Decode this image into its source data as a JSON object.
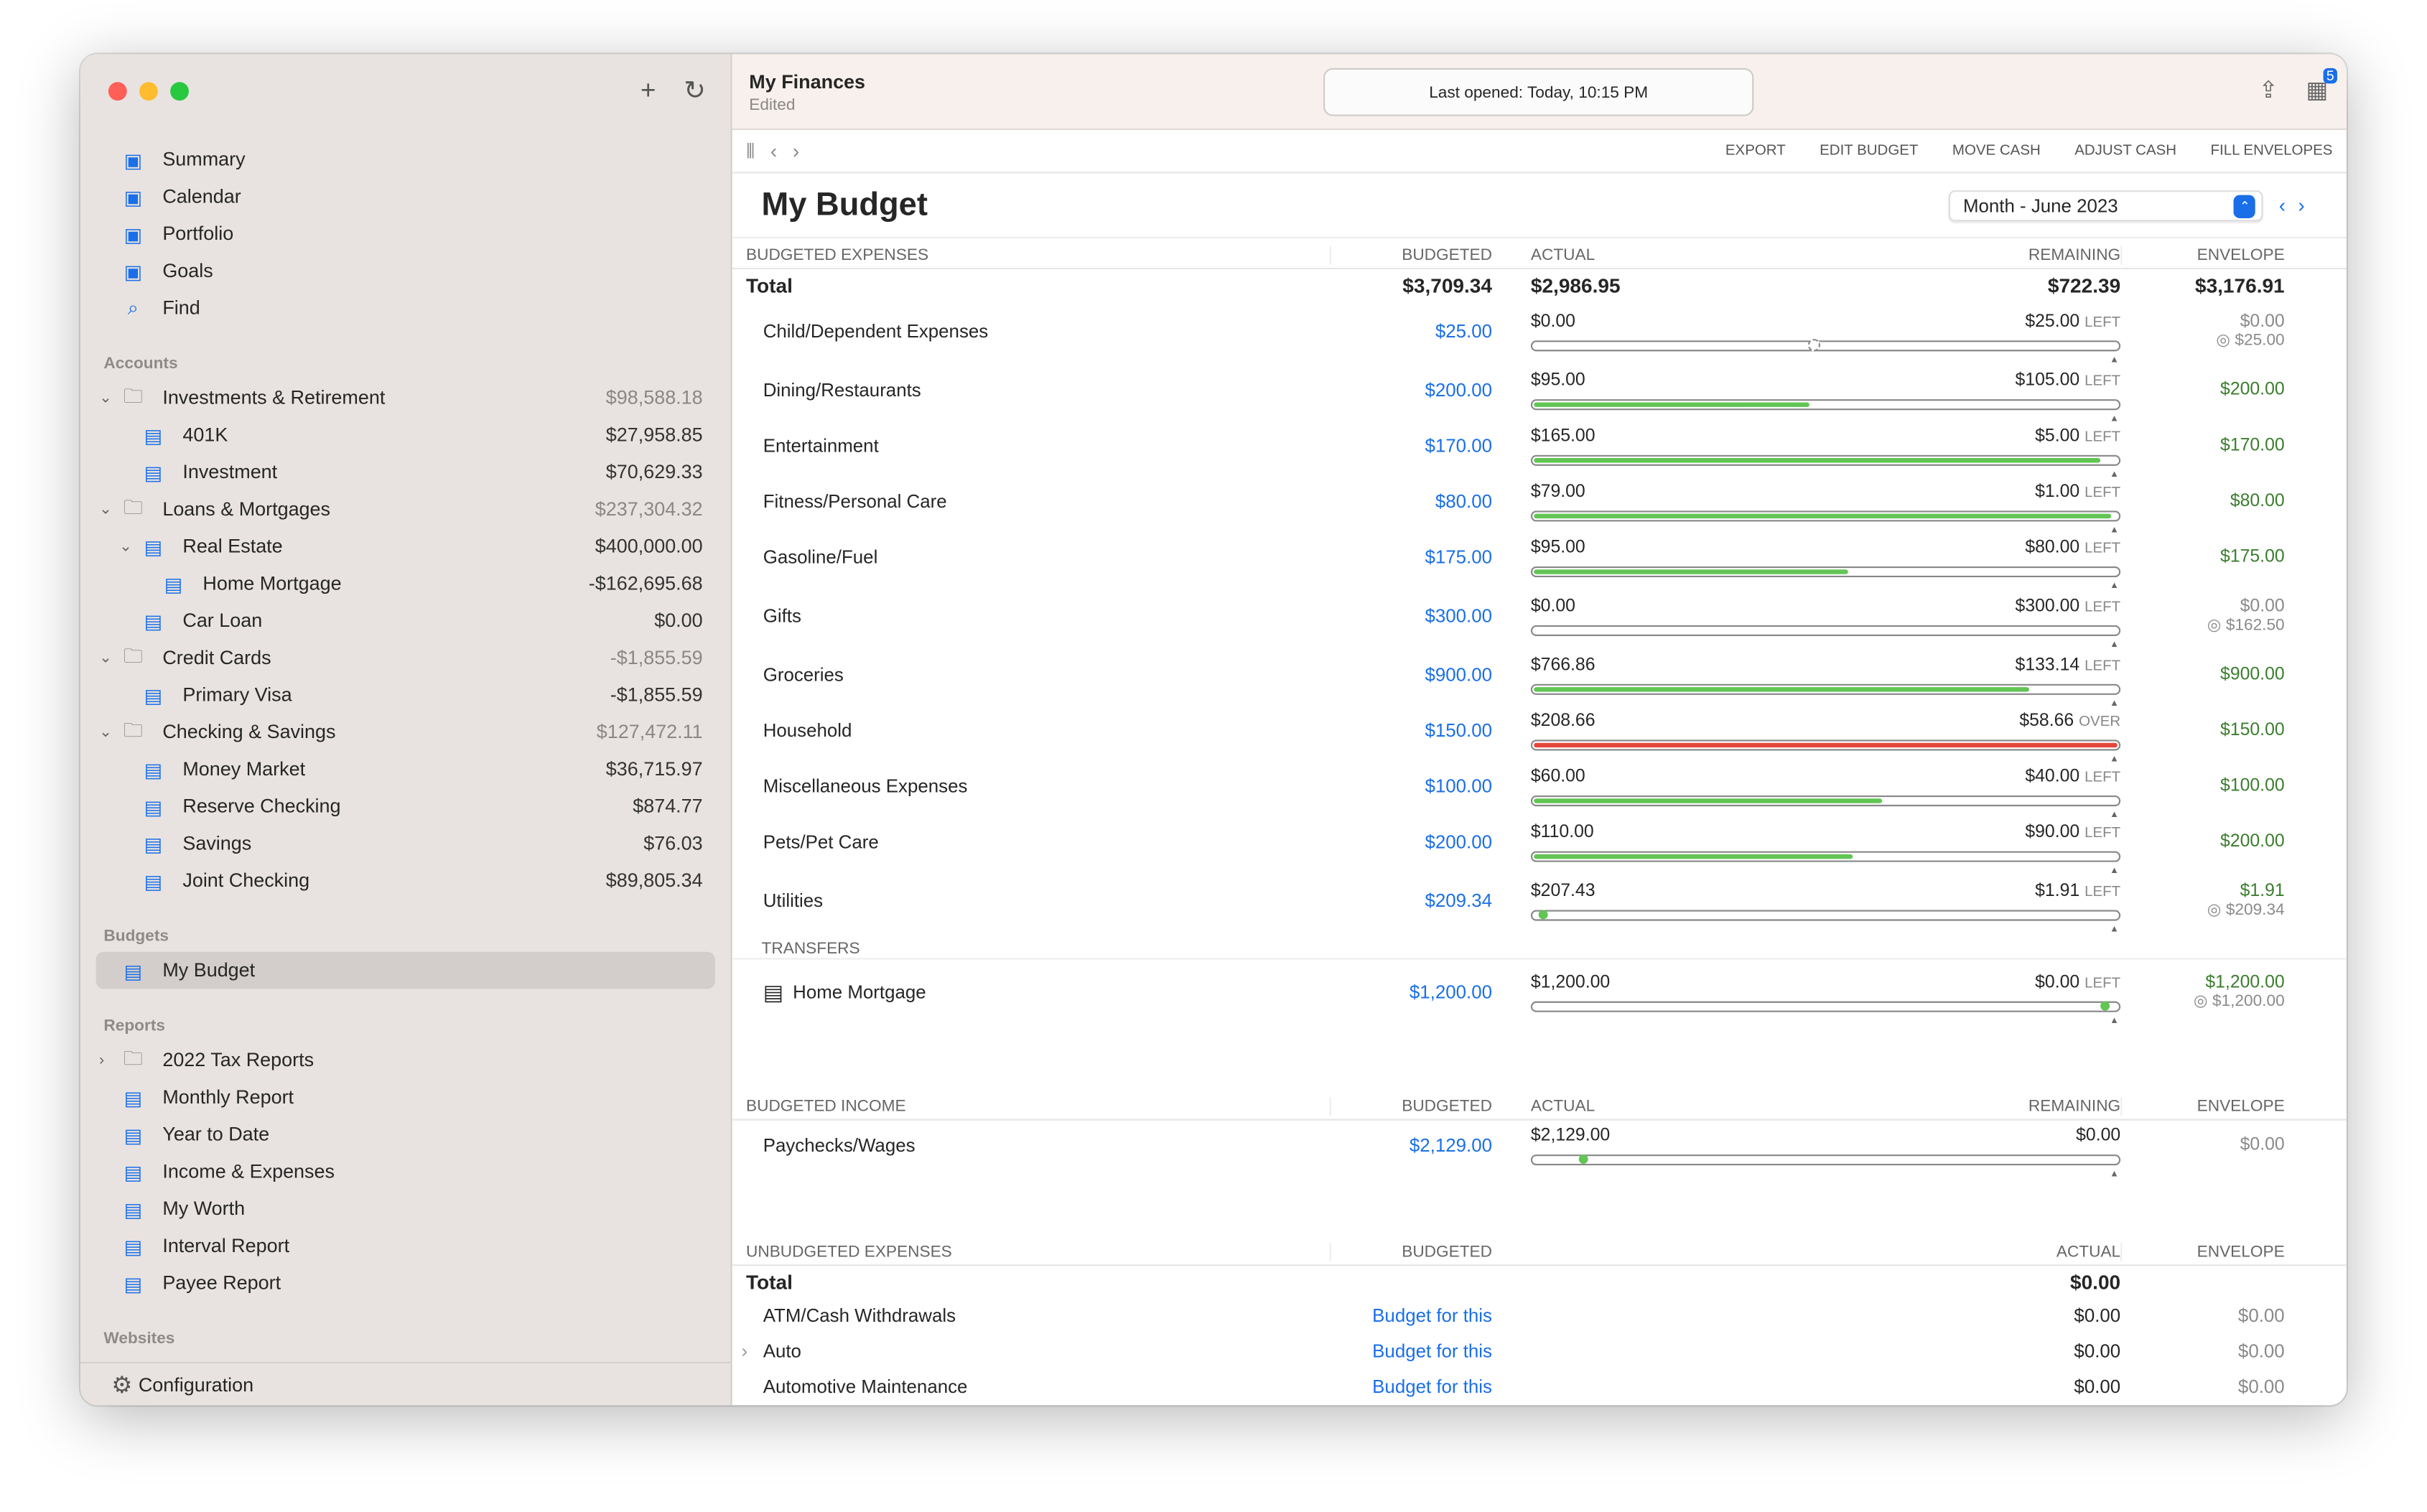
{
  "window": {
    "controls": [
      "close",
      "minimize",
      "zoom"
    ],
    "add_icon": "plus-icon",
    "refresh_icon": "refresh-icon"
  },
  "sidebar": {
    "top": [
      {
        "label": "Summary",
        "icon": "bank-icon"
      },
      {
        "label": "Calendar",
        "icon": "calendar-icon"
      },
      {
        "label": "Portfolio",
        "icon": "briefcase-icon"
      },
      {
        "label": "Goals",
        "icon": "target-icon"
      },
      {
        "label": "Find",
        "icon": "search-icon"
      }
    ],
    "accounts_heading": "Accounts",
    "accounts": [
      {
        "label": "Investments & Retirement",
        "amount": "$98,588.18",
        "level": 0,
        "group": true,
        "icon": "folder-icon"
      },
      {
        "label": "401K",
        "amount": "$27,958.85",
        "level": 1,
        "icon": "sunrise-icon"
      },
      {
        "label": "Investment",
        "amount": "$70,629.33",
        "level": 1,
        "icon": "chart-up-icon"
      },
      {
        "label": "Loans & Mortgages",
        "amount": "$237,304.32",
        "level": 0,
        "group": true,
        "icon": "folder-icon"
      },
      {
        "label": "Real Estate",
        "amount": "$400,000.00",
        "level": 1,
        "expand": true,
        "icon": "house-icon"
      },
      {
        "label": "Home Mortgage",
        "amount": "-$162,695.68",
        "level": 2,
        "icon": "contract-icon"
      },
      {
        "label": "Car Loan",
        "amount": "$0.00",
        "level": 1,
        "icon": "contract-icon"
      },
      {
        "label": "Credit Cards",
        "amount": "-$1,855.59",
        "level": 0,
        "group": true,
        "icon": "folder-icon"
      },
      {
        "label": "Primary Visa",
        "amount": "-$1,855.59",
        "level": 1,
        "icon": "credit-card-icon"
      },
      {
        "label": "Checking & Savings",
        "amount": "$127,472.11",
        "level": 0,
        "group": true,
        "icon": "folder-icon"
      },
      {
        "label": "Money Market",
        "amount": "$36,715.97",
        "level": 1,
        "icon": "bank-chart-icon"
      },
      {
        "label": "Reserve Checking",
        "amount": "$874.77",
        "level": 1,
        "icon": "check-pen-icon"
      },
      {
        "label": "Savings",
        "amount": "$76.03",
        "level": 1,
        "icon": "piggy-bank-icon"
      },
      {
        "label": "Joint Checking",
        "amount": "$89,805.34",
        "level": 1,
        "icon": "check-pen-icon"
      }
    ],
    "budgets_heading": "Budgets",
    "budgets": [
      {
        "label": "My Budget",
        "selected": true,
        "icon": "envelope-icon"
      }
    ],
    "reports_heading": "Reports",
    "reports": [
      {
        "label": "2022 Tax Reports",
        "folder": true,
        "icon": "folder-icon"
      },
      {
        "label": "Monthly Report",
        "icon": "pie-chart-icon"
      },
      {
        "label": "Year to Date",
        "icon": "pie-chart-icon"
      },
      {
        "label": "Income & Expenses",
        "icon": "pie-chart-icon"
      },
      {
        "label": "My Worth",
        "icon": "pie-chart-icon"
      },
      {
        "label": "Interval Report",
        "icon": "report-icon"
      },
      {
        "label": "Payee Report",
        "icon": "table-icon"
      }
    ],
    "websites_heading": "Websites",
    "configuration": "Configuration"
  },
  "titlebar": {
    "doc_title": "My Finances",
    "doc_status": "Edited",
    "last_opened": "Last opened: Today, 10:15 PM",
    "badge": "5"
  },
  "toolbar": {
    "actions": [
      "EXPORT",
      "EDIT BUDGET",
      "MOVE CASH",
      "ADJUST CASH",
      "FILL ENVELOPES"
    ]
  },
  "budget": {
    "title": "My Budget",
    "period": "Month - June 2023",
    "expenses_header": {
      "name": "BUDGETED EXPENSES",
      "budgeted": "BUDGETED",
      "actual": "ACTUAL",
      "remaining": "REMAINING",
      "envelope": "ENVELOPE"
    },
    "expenses_total": {
      "label": "Total",
      "budgeted": "$3,709.34",
      "actual": "$2,986.95",
      "remaining": "$722.39",
      "envelope": "$3,176.91"
    },
    "expenses": [
      {
        "name": "Child/Dependent Expenses",
        "budgeted": "$25.00",
        "actual": "$0.00",
        "remaining": "$25.00",
        "state": "LEFT",
        "progress": 0,
        "marker": 0.48,
        "marker_style": "dashed",
        "envelope": "$0.00",
        "target": "$25.00"
      },
      {
        "name": "Dining/Restaurants",
        "budgeted": "$200.00",
        "actual": "$95.00",
        "remaining": "$105.00",
        "state": "LEFT",
        "progress": 0.475,
        "envelope": "$200.00"
      },
      {
        "name": "Entertainment",
        "budgeted": "$170.00",
        "actual": "$165.00",
        "remaining": "$5.00",
        "state": "LEFT",
        "progress": 0.97,
        "envelope": "$170.00"
      },
      {
        "name": "Fitness/Personal Care",
        "budgeted": "$80.00",
        "actual": "$79.00",
        "remaining": "$1.00",
        "state": "LEFT",
        "progress": 0.99,
        "envelope": "$80.00"
      },
      {
        "name": "Gasoline/Fuel",
        "budgeted": "$175.00",
        "actual": "$95.00",
        "remaining": "$80.00",
        "state": "LEFT",
        "progress": 0.54,
        "envelope": "$175.00"
      },
      {
        "name": "Gifts",
        "budgeted": "$300.00",
        "actual": "$0.00",
        "remaining": "$300.00",
        "state": "LEFT",
        "progress": 0,
        "envelope": "$0.00",
        "target": "$162.50"
      },
      {
        "name": "Groceries",
        "budgeted": "$900.00",
        "actual": "$766.86",
        "remaining": "$133.14",
        "state": "LEFT",
        "progress": 0.85,
        "envelope": "$900.00"
      },
      {
        "name": "Household",
        "budgeted": "$150.00",
        "actual": "$208.66",
        "remaining": "$58.66",
        "state": "OVER",
        "progress": 1,
        "envelope": "$150.00"
      },
      {
        "name": "Miscellaneous Expenses",
        "budgeted": "$100.00",
        "actual": "$60.00",
        "remaining": "$40.00",
        "state": "LEFT",
        "progress": 0.6,
        "envelope": "$100.00"
      },
      {
        "name": "Pets/Pet Care",
        "budgeted": "$200.00",
        "actual": "$110.00",
        "remaining": "$90.00",
        "state": "LEFT",
        "progress": 0.55,
        "envelope": "$200.00"
      },
      {
        "name": "Utilities",
        "budgeted": "$209.34",
        "actual": "$207.43",
        "remaining": "$1.91",
        "state": "LEFT",
        "progress": 0,
        "marker": 0.02,
        "envelope": "$1.91",
        "target": "$209.34"
      }
    ],
    "transfers_heading": "TRANSFERS",
    "transfers": [
      {
        "name": "Home Mortgage",
        "budgeted": "$1,200.00",
        "actual": "$1,200.00",
        "remaining": "$0.00",
        "state": "LEFT",
        "progress": 0,
        "marker": 0.98,
        "envelope": "$1,200.00",
        "target": "$1,200.00",
        "icon": "contract-icon"
      }
    ],
    "income_header": {
      "name": "BUDGETED INCOME",
      "budgeted": "BUDGETED",
      "actual": "ACTUAL",
      "remaining": "REMAINING",
      "envelope": "ENVELOPE"
    },
    "income": [
      {
        "name": "Paychecks/Wages",
        "budgeted": "$2,129.00",
        "actual": "$2,129.00",
        "remaining": "$0.00",
        "state": "",
        "progress": 0,
        "marker": 0.09,
        "envelope": "$0.00"
      }
    ],
    "unbudgeted_header": {
      "name": "UNBUDGETED EXPENSES",
      "budgeted": "BUDGETED",
      "actual": "ACTUAL",
      "envelope": "ENVELOPE"
    },
    "unbudgeted_total": {
      "label": "Total",
      "actual": "$0.00"
    },
    "unbudgeted": [
      {
        "name": "ATM/Cash Withdrawals",
        "link": "Budget for this",
        "actual": "$0.00",
        "envelope": "$0.00"
      },
      {
        "name": "Auto",
        "link": "Budget for this",
        "actual": "$0.00",
        "envelope": "$0.00",
        "expandable": true
      },
      {
        "name": "Automotive Maintenance",
        "link": "Budget for this",
        "actual": "$0.00",
        "envelope": "$0.00"
      }
    ]
  },
  "colors": {
    "accent": "#1a6fe8",
    "progress": "#62c554",
    "over": "#e5463b",
    "envelope_funded": "#3b7d2e",
    "sidebar_bg": "#e8e3e0",
    "titlebar_bg": "#f8f0ec"
  }
}
